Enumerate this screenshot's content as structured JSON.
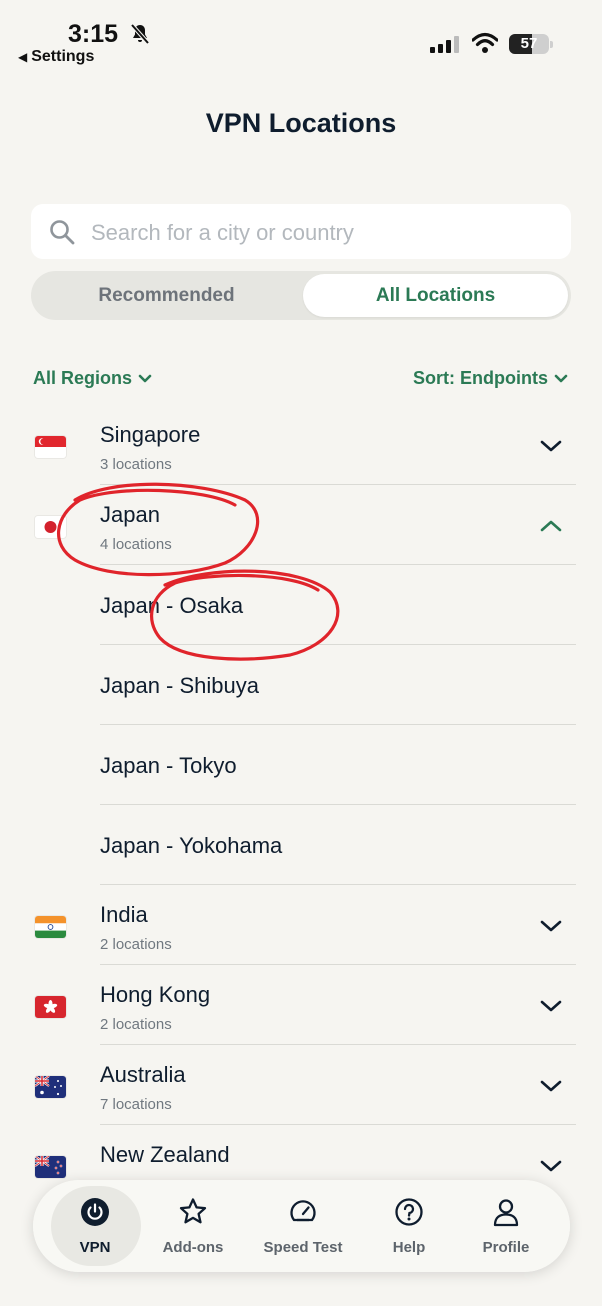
{
  "status_bar": {
    "time": "3:15",
    "back_label": "Settings",
    "battery": "57"
  },
  "page": {
    "title": "VPN Locations"
  },
  "search": {
    "placeholder": "Search for a city or country"
  },
  "tabs": {
    "recommended": "Recommended",
    "all": "All Locations",
    "selected": "All Locations"
  },
  "filters": {
    "regions": "All Regions",
    "sort": "Sort: Endpoints"
  },
  "countries": [
    {
      "name": "Singapore",
      "count": "3 locations",
      "expanded": false
    },
    {
      "name": "Japan",
      "count": "4 locations",
      "expanded": true,
      "cities": [
        "Japan - Osaka",
        "Japan - Shibuya",
        "Japan - Tokyo",
        "Japan - Yokohama"
      ]
    },
    {
      "name": "India",
      "count": "2 locations",
      "expanded": false
    },
    {
      "name": "Hong Kong",
      "count": "2 locations",
      "expanded": false
    },
    {
      "name": "Australia",
      "count": "7 locations",
      "expanded": false
    },
    {
      "name": "New Zealand",
      "count": "",
      "expanded": false
    }
  ],
  "nav": {
    "vpn": "VPN",
    "addons": "Add-ons",
    "speed": "Speed Test",
    "help": "Help",
    "profile": "Profile"
  },
  "colors": {
    "accent": "#2b7a55",
    "annotation": "#e0242b",
    "background": "#f6f5f1"
  }
}
